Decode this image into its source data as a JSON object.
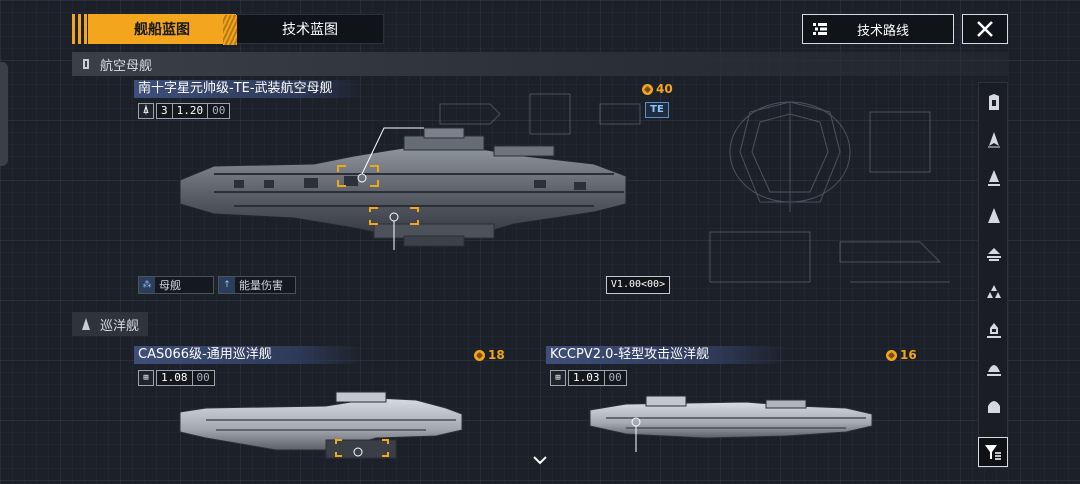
{
  "tabs": [
    {
      "label": "舰船蓝图",
      "active": true
    },
    {
      "label": "技术蓝图",
      "active": false
    }
  ],
  "tech_route": {
    "label": "技术路线",
    "icon": "list-icon"
  },
  "close_icon": "close-icon",
  "sections": {
    "carrier": {
      "label": "航空母舰",
      "icon": "carrier-class-icon"
    },
    "cruiser": {
      "label": "巡洋舰",
      "icon": "cruiser-class-icon"
    }
  },
  "ships": {
    "carrier": {
      "name": "南十字星元帅级-TE-武装航空母舰",
      "cost": "40",
      "count": "3",
      "value": "1.20",
      "value_suffix": "00",
      "badge": "TE",
      "tags": [
        "母舰",
        "能量伤害"
      ],
      "version": "V1.00<00>"
    },
    "cruiser_a": {
      "name": "CAS066级-通用巡洋舰",
      "cost": "18",
      "value": "1.08",
      "value_suffix": "00"
    },
    "cruiser_b": {
      "name": "KCCPV2.0-轻型攻击巡洋舰",
      "cost": "16",
      "value": "1.03",
      "value_suffix": "00"
    }
  },
  "sidebar_icons": [
    "carrier-class-icon",
    "frigate-class-icon",
    "destroyer-class-icon",
    "cruiser-class-icon",
    "battlecruiser-class-icon",
    "fighter-group-icon",
    "corvette-class-icon",
    "auxiliary-class-icon",
    "capital-class-icon"
  ],
  "filter_icon": "filter-icon",
  "colors": {
    "accent": "#f2a51d",
    "title_bg": "#3f4f7a",
    "background": "#1c2029"
  }
}
